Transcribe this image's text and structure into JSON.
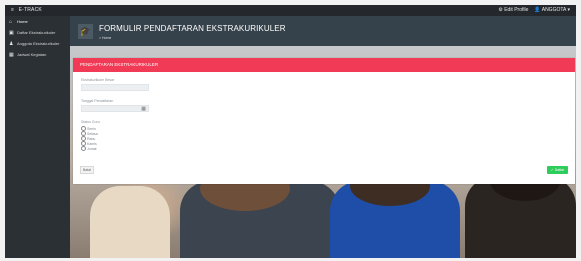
{
  "app": {
    "brand": "E-TRACK",
    "brand_icon": "menu-bars-icon"
  },
  "topbar": {
    "profile_label": "Edit Profile",
    "user_menu": "ANGGOTA"
  },
  "sidebar": {
    "items": [
      {
        "label": "Home",
        "icon": "home-icon"
      },
      {
        "label": "Daftar Ekstrakurikuler",
        "icon": "briefcase-icon"
      },
      {
        "label": "Anggota Ekstrakurikuler",
        "icon": "user-icon"
      },
      {
        "label": "Jadwal Kegiatan",
        "icon": "calendar-icon"
      }
    ]
  },
  "header": {
    "title": "FORMULIR PENDAFTARAN EKSTRAKURIKULER",
    "breadcrumb": "> Home",
    "icon": "graduation-cap-icon"
  },
  "form": {
    "card_title": "PENDAFTARAN EKSTRAKURIKULER",
    "field1_label": "Ekstrakurikuler Besar",
    "field2_label": "Tanggal Pendaftaran",
    "field3_label": "Status Guru",
    "options": [
      "Senin",
      "Selasa",
      "Rabu",
      "Kamis",
      "Jumat"
    ],
    "back_label": "Batal",
    "save_label": "Daftar"
  },
  "colors": {
    "accent": "#f13a55",
    "save": "#2ecc5a",
    "header": "#36424b",
    "sidebar": "#2b3034"
  }
}
